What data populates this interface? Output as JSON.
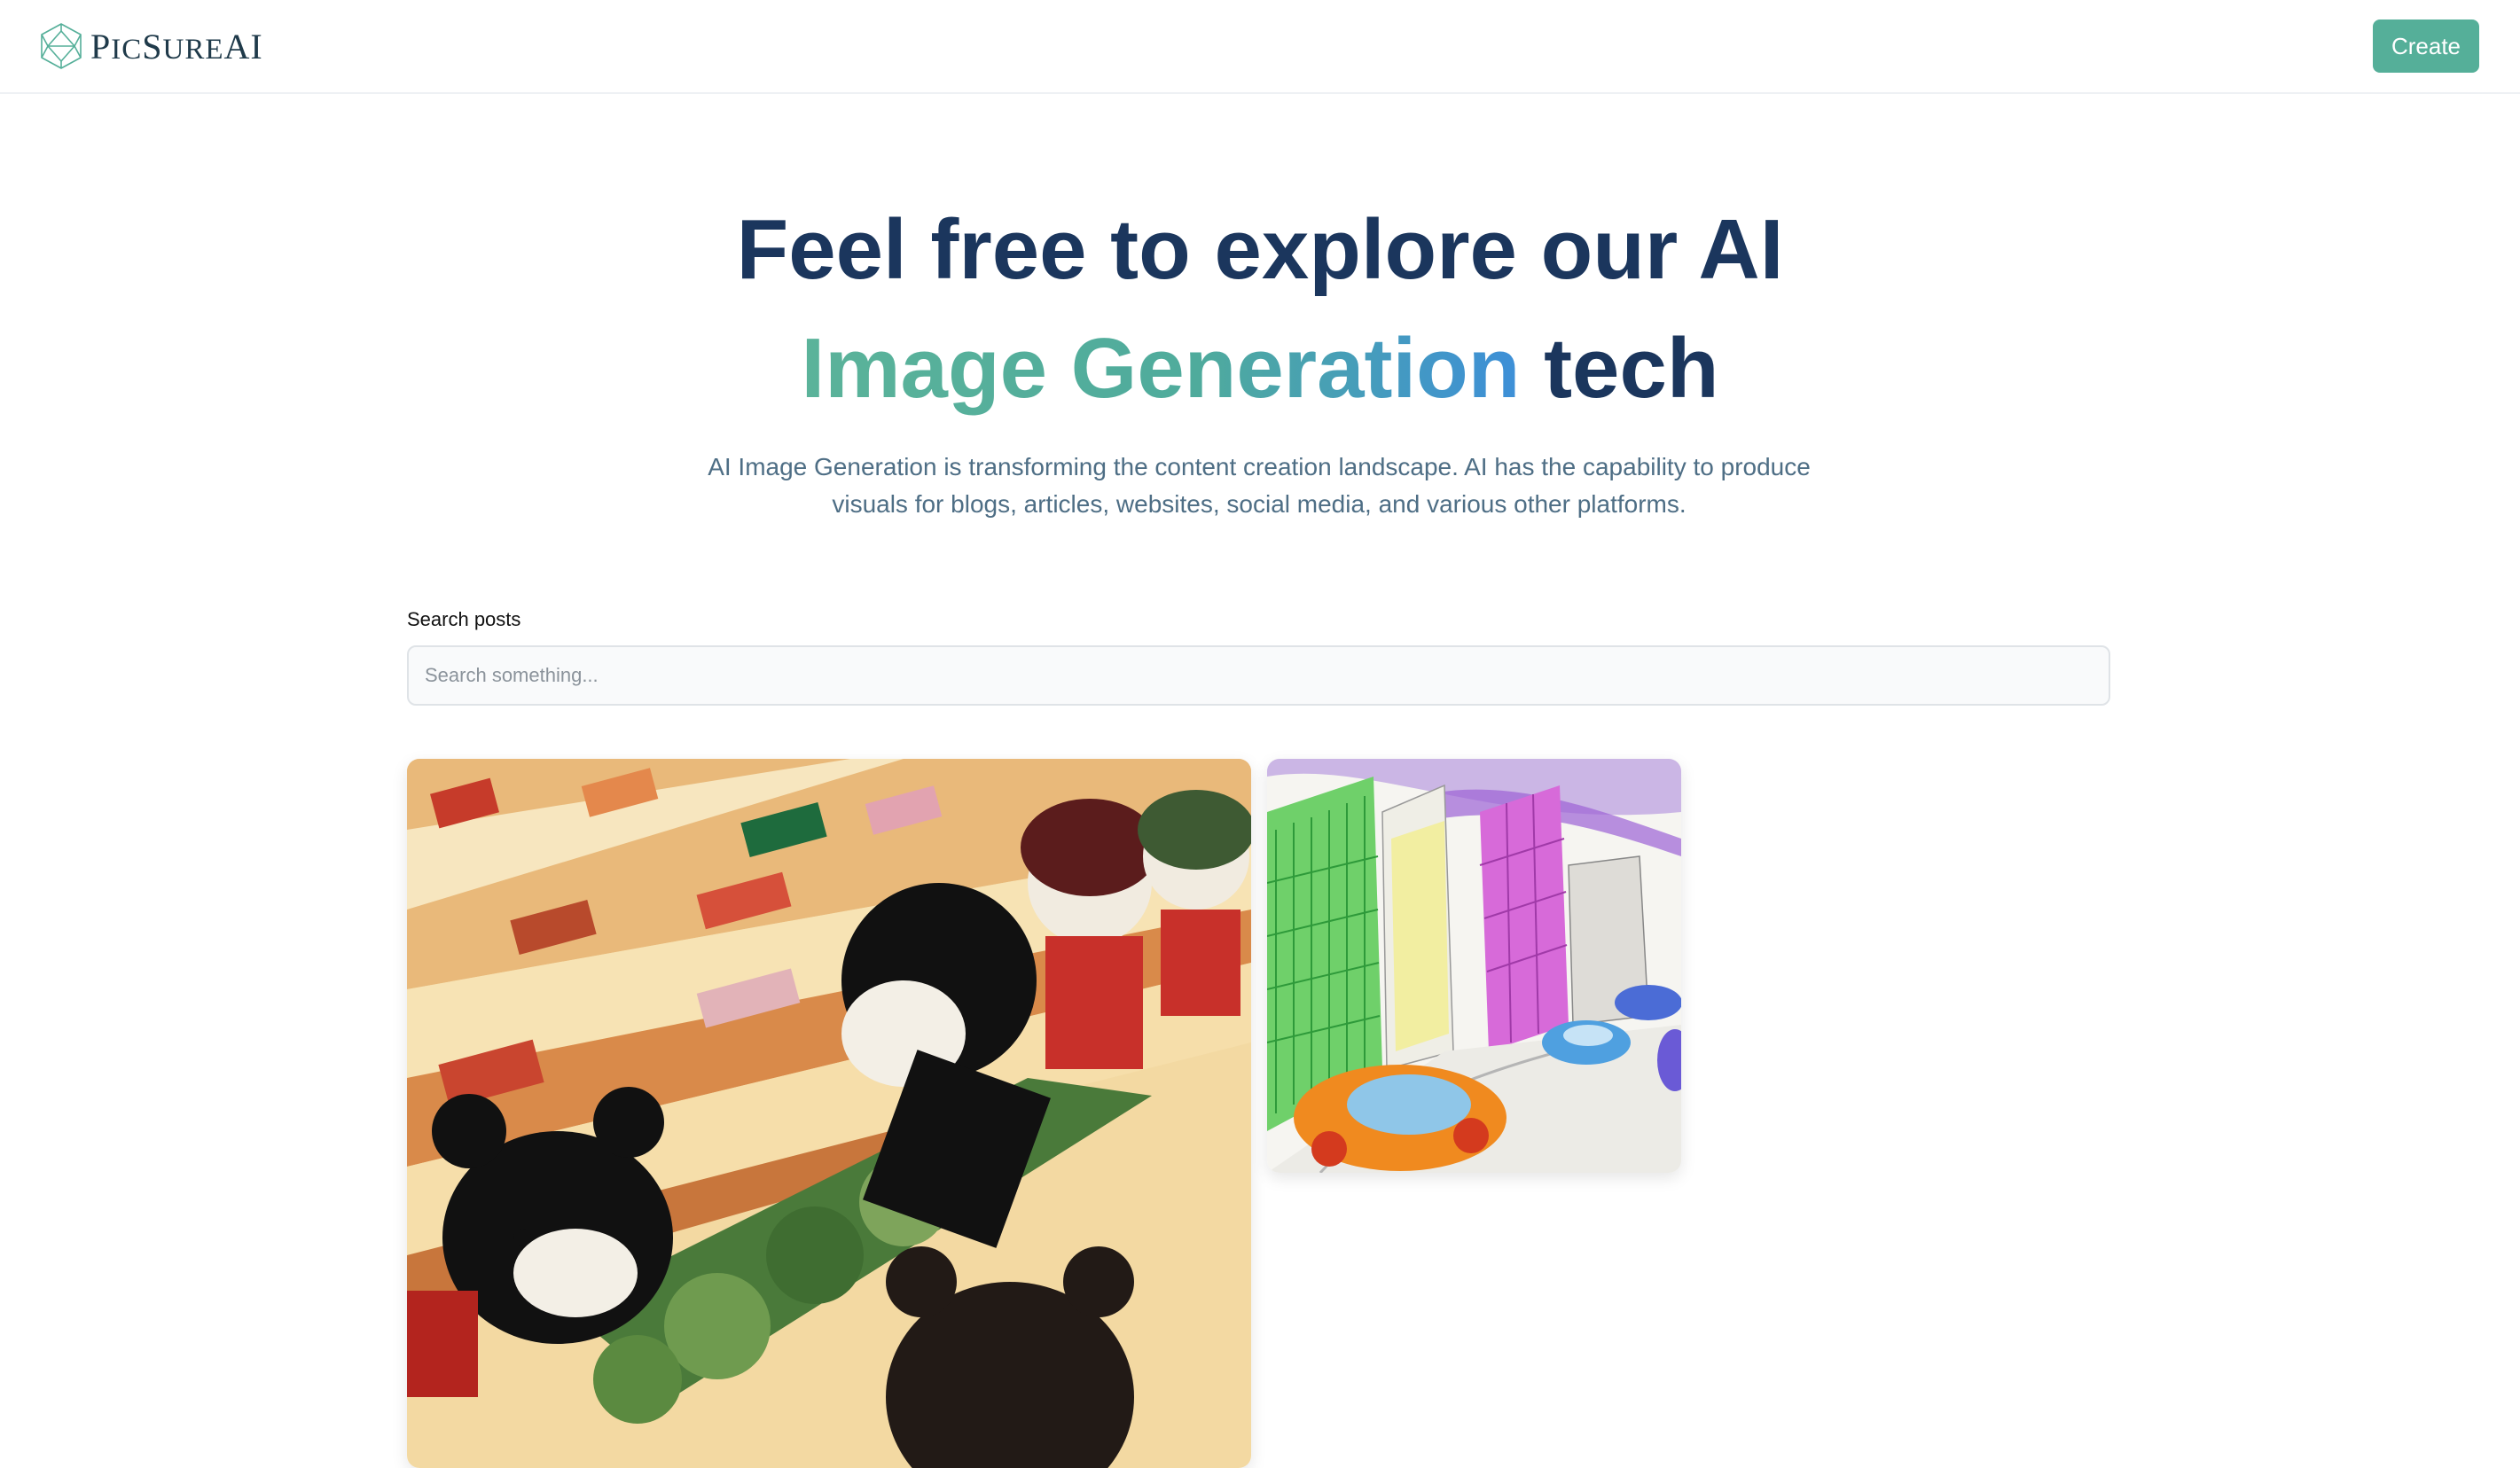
{
  "header": {
    "logo_text_prefix": "P",
    "logo_text_a": "IC",
    "logo_text_s": "S",
    "logo_text_b": "URE",
    "logo_text_ai": "AI",
    "logo_icon": "crystal-logo-icon",
    "create_label": "Create"
  },
  "hero": {
    "title_line1": "Feel free to explore our AI",
    "title_highlight": "Image Generation",
    "title_tail": "tech",
    "description": "AI Image Generation is transforming the content creation landscape. AI has the capability to produce visuals for blogs, articles, websites, social media, and various other platforms."
  },
  "search": {
    "label": "Search posts",
    "placeholder": "Search something...",
    "value": ""
  },
  "gallery": {
    "items": [
      {
        "alt": "bears-shopping-vegetables-drawing"
      },
      {
        "alt": "city-street-cars-crayon-drawing"
      }
    ]
  },
  "colors": {
    "brand": "#55af99",
    "heading": "#1b365d",
    "gradient_start": "#5bb39a",
    "gradient_end": "#3d8fd8",
    "body_text": "#4e6e85"
  }
}
